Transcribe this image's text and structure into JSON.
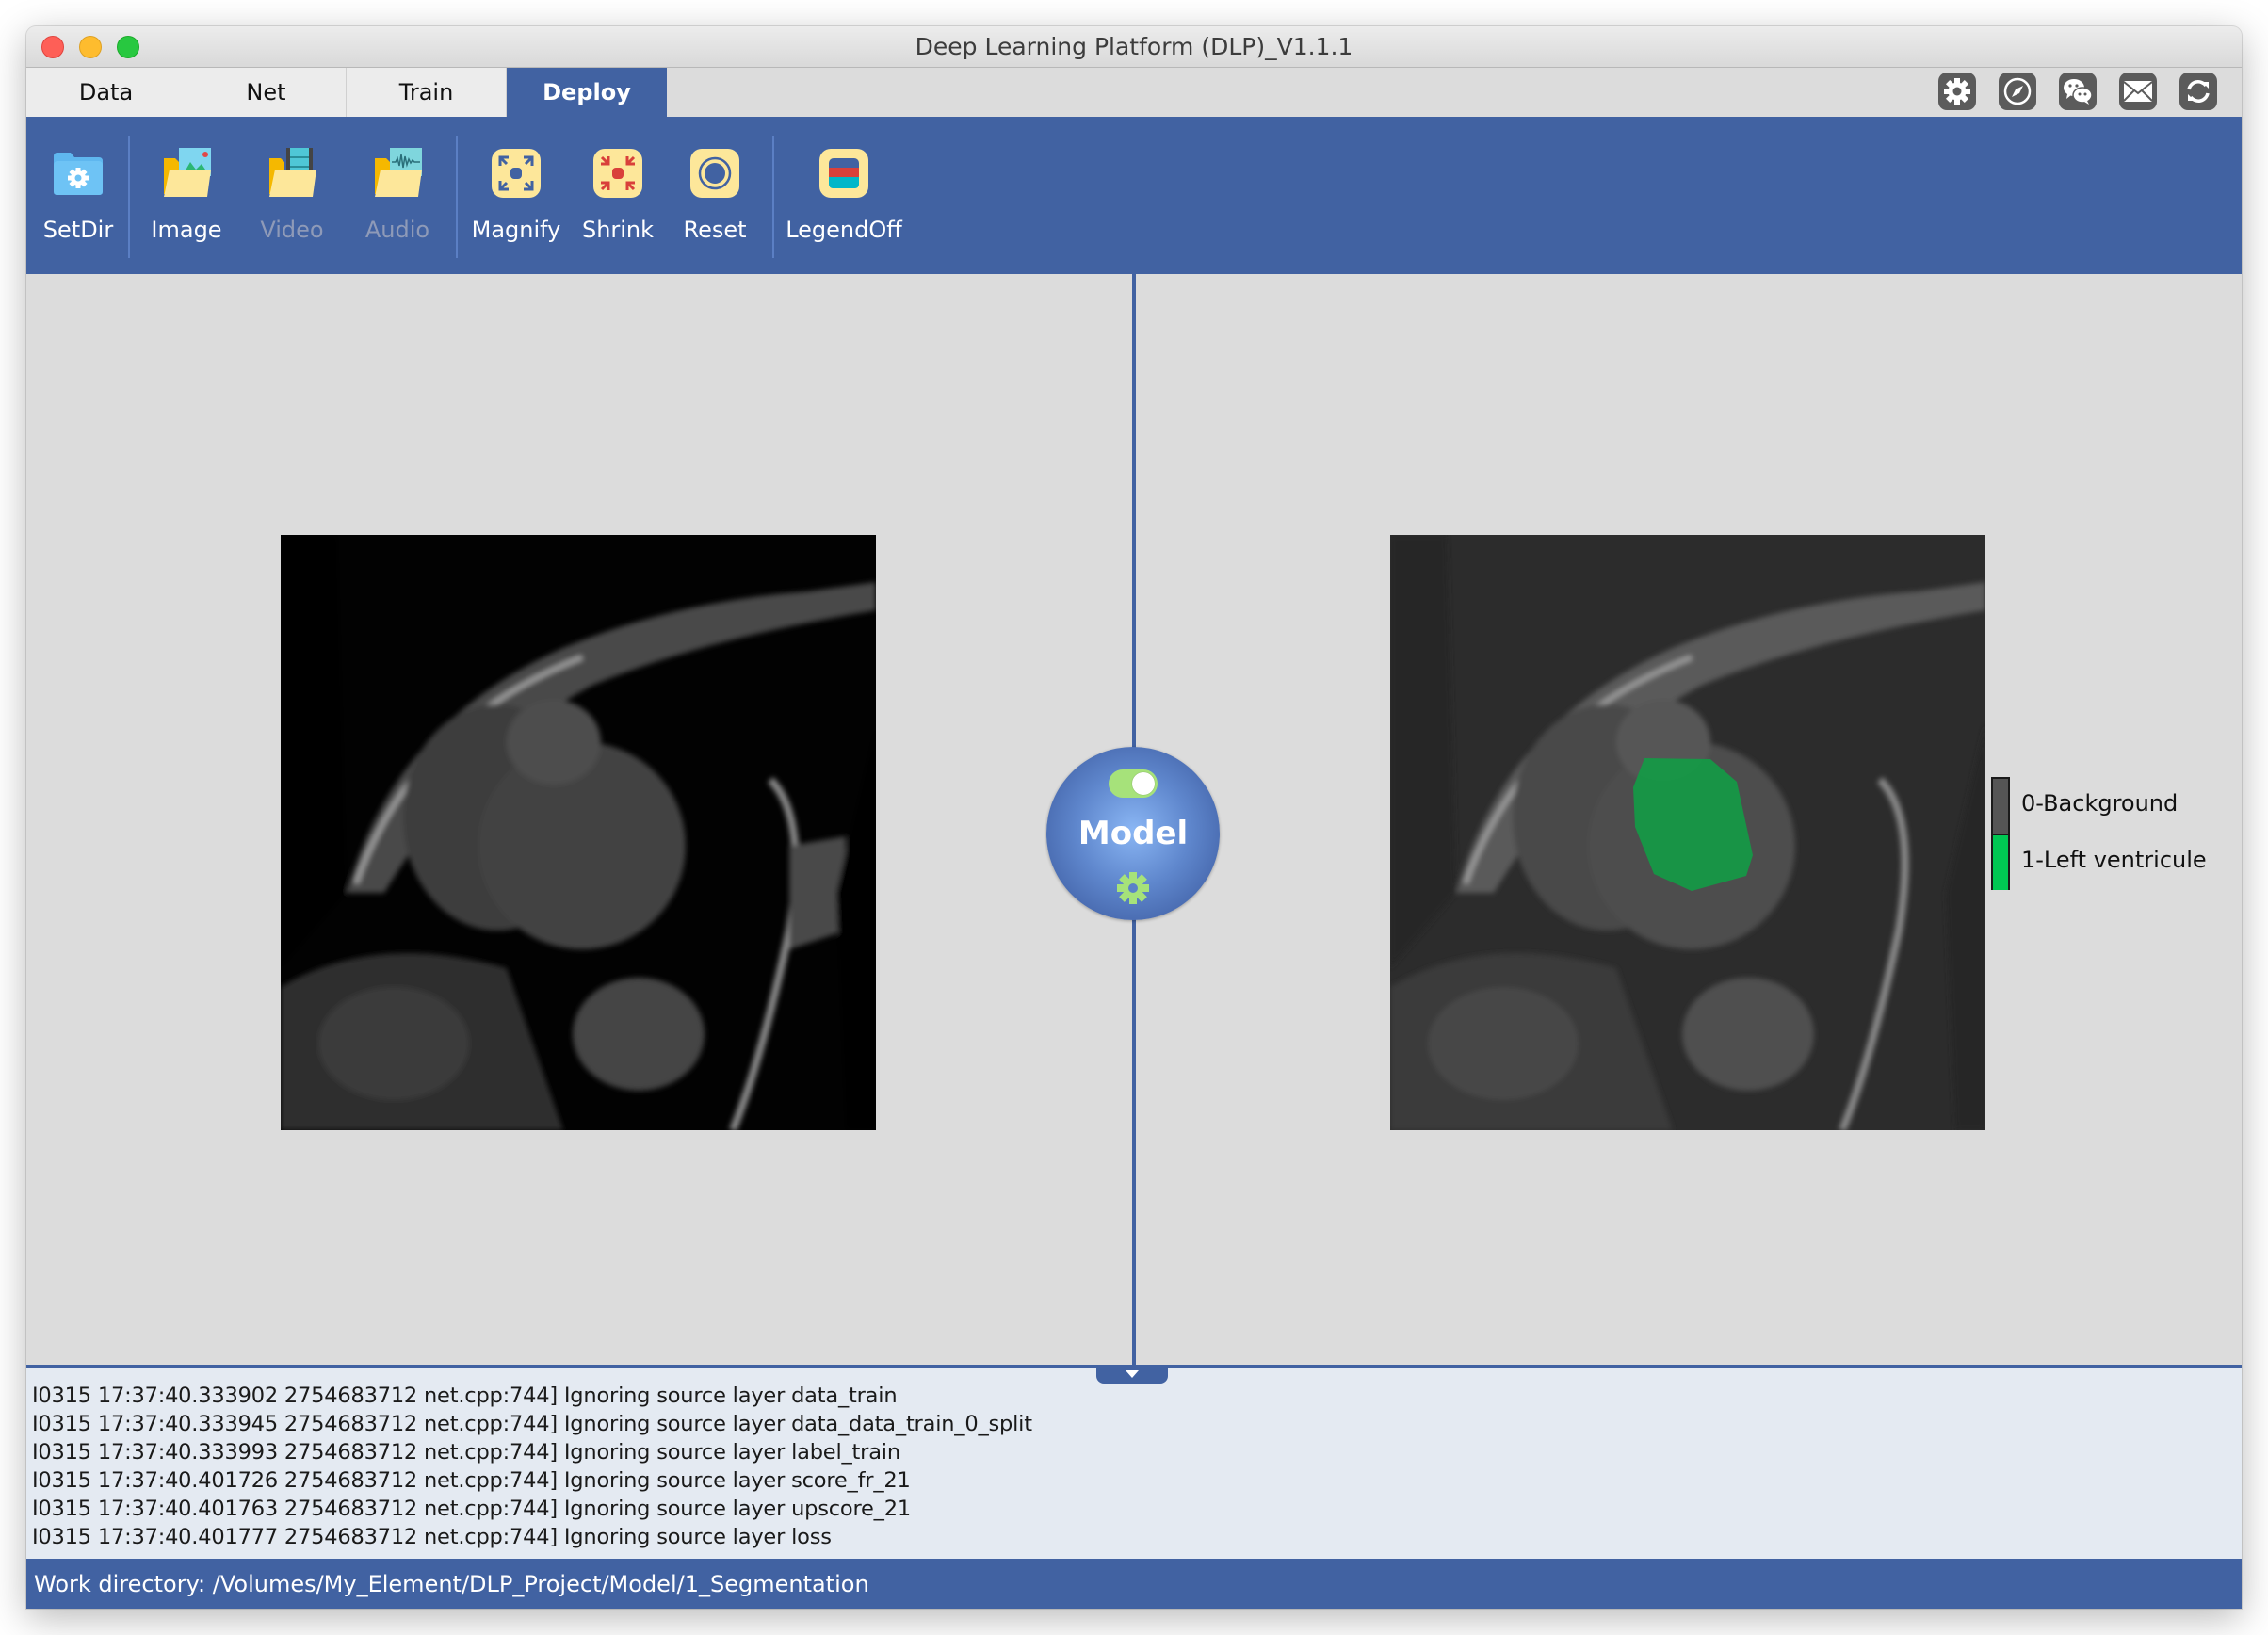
{
  "window": {
    "title": "Deep Learning Platform (DLP)_V1.1.1"
  },
  "tabs": [
    {
      "label": "Data",
      "active": false
    },
    {
      "label": "Net",
      "active": false
    },
    {
      "label": "Train",
      "active": false
    },
    {
      "label": "Deploy",
      "active": true
    }
  ],
  "top_icons": [
    "gear-icon",
    "compass-icon",
    "wechat-icon",
    "mail-icon",
    "refresh-icon"
  ],
  "toolbar": {
    "setdir": "SetDir",
    "image": "Image",
    "video": "Video",
    "audio": "Audio",
    "magnify": "Magnify",
    "shrink": "Shrink",
    "reset": "Reset",
    "legend_off": "LegendOff"
  },
  "model": {
    "label": "Model",
    "toggle_on": true
  },
  "legend": {
    "items": [
      {
        "label": "0-Background",
        "color": "#555555"
      },
      {
        "label": "1-Left ventricule",
        "color": "#00c853"
      }
    ]
  },
  "log": {
    "lines": [
      "I0315 17:37:40.333902 2754683712 net.cpp:744] Ignoring source layer data_train",
      "I0315 17:37:40.333945 2754683712 net.cpp:744] Ignoring source layer data_data_train_0_split",
      "I0315 17:37:40.333993 2754683712 net.cpp:744] Ignoring source layer label_train",
      "I0315 17:37:40.401726 2754683712 net.cpp:744] Ignoring source layer score_fr_21",
      "I0315 17:37:40.401763 2754683712 net.cpp:744] Ignoring source layer upscore_21",
      "I0315 17:37:40.401777 2754683712 net.cpp:744] Ignoring source layer loss"
    ]
  },
  "status": {
    "work_directory": "Work directory:  /Volumes/My_Element/DLP_Project/Model/1_Segmentation"
  },
  "colors": {
    "accent": "#4162a2",
    "segmentation": "#00c853"
  }
}
